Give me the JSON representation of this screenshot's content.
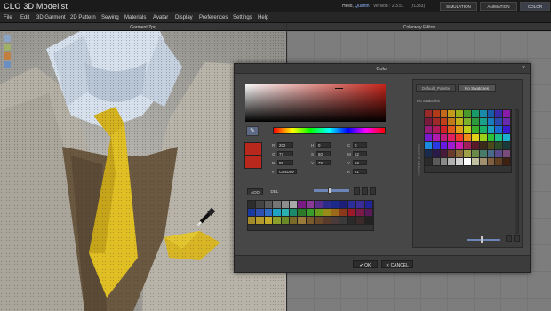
{
  "app": {
    "logo_clo": "CLO",
    "logo_name": "3D Modelist",
    "hello_prefix": "Hello,",
    "user": "Quanth",
    "version_label": "Version : 2.3.51",
    "build_label": "(r1333)",
    "modes": [
      "SIMULATION",
      "ANIMATION",
      "COLOR"
    ],
    "active_mode": "COLOR"
  },
  "menu": [
    "File",
    "Edit",
    "3D Garment",
    "2D Pattern",
    "Sewing",
    "Materials",
    "Avatar",
    "Display",
    "Preferences",
    "Settings",
    "Help"
  ],
  "panels": {
    "garment_title": "Garment.Zprj",
    "colorways_title": "Colorway Editor"
  },
  "color_dialog": {
    "title": "Color",
    "channels_left": [
      {
        "label": "R",
        "value": "202"
      },
      {
        "label": "G",
        "value": "77"
      },
      {
        "label": "B",
        "value": "89"
      },
      {
        "label": "#",
        "value": "CA4D59"
      }
    ],
    "channels_mid": [
      {
        "label": "H",
        "value": "0"
      },
      {
        "label": "S",
        "value": "60"
      },
      {
        "label": "V",
        "value": "79"
      }
    ],
    "channels_right": [
      {
        "label": "C",
        "value": "0"
      },
      {
        "label": "M",
        "value": "62"
      },
      {
        "label": "Y",
        "value": "56"
      },
      {
        "label": "K",
        "value": "21"
      }
    ],
    "add_label": "ADD",
    "del_label": "DEL",
    "palette_colors": [
      "#2d2d2d",
      "#444444",
      "#5c5c5c",
      "#757575",
      "#8e8e8e",
      "#a8a8a8",
      "#7a1a84",
      "#8a3a96",
      "#5b2d8a",
      "#2b2b8a",
      "#1b2a8a",
      "#1d1d7a",
      "#2c2c9a",
      "#3b2c9a",
      "#222299",
      "#1b3aa0",
      "#2c4fb0",
      "#2e6ec6",
      "#1fa3c4",
      "#2ab0b0",
      "#1a8a6a",
      "#2a7a2a",
      "#3a9a2a",
      "#6a9a1a",
      "#9a8a1a",
      "#9a6a1a",
      "#8a3a1a",
      "#9a1a2a",
      "#7a1a4a",
      "#5a1a5a",
      "#a38b2a",
      "#b49a2a",
      "#c4aa2a",
      "#8aa02a",
      "#6a8a2a",
      "#7a6a2a",
      "#9a7a3a",
      "#7a5a2a",
      "#6a4a2a",
      "#5a3a2a",
      "#4a3a3a",
      "#3a3a3a",
      "#2a2a2a",
      "#3a2a2a",
      "#222222"
    ],
    "library_tabs": [
      "Default_Palette",
      "No Swatches"
    ],
    "active_library_tab": "No Swatches",
    "library_title": "No Swatches",
    "library_side_label": "PALETTE LIBRARY",
    "library_colors": [
      "#9a2a2a",
      "#b03a1a",
      "#c46a1a",
      "#c49a1a",
      "#9ab01a",
      "#4a9a2a",
      "#1a9a6a",
      "#1a8aaa",
      "#1a5aaa",
      "#3a2aaa",
      "#8a1aaa",
      "#7a1a3a",
      "#a02a2a",
      "#c0401a",
      "#c07a1a",
      "#c0b01a",
      "#7ab02a",
      "#2a9a3a",
      "#1aa08a",
      "#1a7ac0",
      "#2a4ab0",
      "#6a2ab0",
      "#9a1a7a",
      "#b01a5a",
      "#d0202a",
      "#e05a1a",
      "#e0a01a",
      "#c0d01a",
      "#3ab02a",
      "#1ab06a",
      "#1aa0c0",
      "#1a6ad0",
      "#3a1ad0",
      "#7a1ad0",
      "#b01ab0",
      "#c01a7a",
      "#e02060",
      "#f03a2a",
      "#f08a1a",
      "#e0d01a",
      "#9ad01a",
      "#2ac03a",
      "#1ac08a",
      "#1ab0d0",
      "#1a8ae0",
      "#2a3ae0",
      "#6a1ae0",
      "#a01ad0",
      "#d01ab0",
      "#a0205a",
      "#5a1a2a",
      "#3a2a1a",
      "#4a4a1a",
      "#2a4a2a",
      "#1a3a3a",
      "#1a2a4a",
      "#2a1a4a",
      "#4a1a3a",
      "#6a3a2a",
      "#8a6a3a",
      "#a0a04a",
      "#6a8a4a",
      "#4a7a6a",
      "#4a6a8a",
      "#5a4a8a",
      "#7a4a7a",
      "#2a2a2a",
      "#5a5a5a",
      "#8a8a8a",
      "#b0b0b0",
      "#d0d0d0",
      "#ffffff",
      "#c0c0a0",
      "#a09070",
      "#806040",
      "#604020",
      "#402010"
    ],
    "ok_label": "OK",
    "cancel_label": "CANCEL"
  }
}
